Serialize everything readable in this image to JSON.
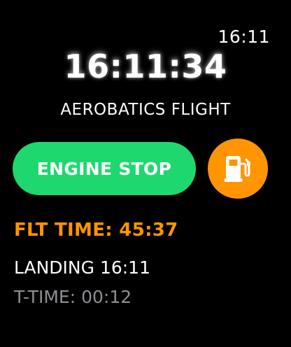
{
  "status_bar": {
    "time": "16:11"
  },
  "clock": {
    "time": "16:11:34"
  },
  "flight": {
    "title": "AEROBATICS FLIGHT"
  },
  "actions": {
    "engine_stop_label": "ENGINE STOP",
    "fuel_icon": "fuel-pump-icon"
  },
  "stats": {
    "flt_time": "FLT TIME: 45:37",
    "landing": "LANDING 16:11",
    "t_time": "T-TIME: 00:12"
  },
  "colors": {
    "background": "#000000",
    "engine_button": "#1ed86f",
    "fuel_button": "#ff9500",
    "flt_time_text": "#ff9500",
    "secondary_text": "#8e8e93"
  }
}
